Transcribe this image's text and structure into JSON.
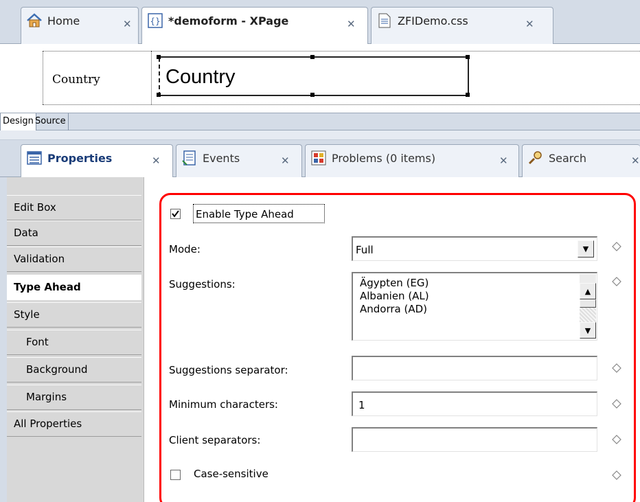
{
  "editor_tabs": [
    {
      "label": "Home",
      "icon": "home-icon"
    },
    {
      "label": "*demoform - XPage",
      "icon": "xpage-icon"
    },
    {
      "label": "ZFIDemo.css",
      "icon": "css-file-icon"
    }
  ],
  "canvas": {
    "label_text": "Country",
    "editbox_text": "Country"
  },
  "design_tabs": [
    "Design",
    "Source"
  ],
  "view_tabs": [
    {
      "label": "Properties",
      "icon": "properties-icon"
    },
    {
      "label": "Events",
      "icon": "events-icon"
    },
    {
      "label": "Problems (0 items)",
      "icon": "problems-icon"
    },
    {
      "label": "Search",
      "icon": "search-icon"
    }
  ],
  "nav": [
    {
      "label": "Edit Box"
    },
    {
      "label": "Data"
    },
    {
      "label": "Validation"
    },
    {
      "label": "Type Ahead"
    },
    {
      "label": "Style"
    },
    {
      "label": "Font"
    },
    {
      "label": "Background"
    },
    {
      "label": "Margins"
    },
    {
      "label": "All Properties"
    }
  ],
  "form": {
    "enable_label": "Enable Type Ahead",
    "enable_checked": true,
    "mode_label": "Mode:",
    "mode_value": "Full",
    "suggestions_label": "Suggestions:",
    "suggestions": [
      "Ägypten (EG)",
      "Albanien (AL)",
      "Andorra (AD)"
    ],
    "separator_label": "Suggestions separator:",
    "separator_value": "",
    "min_chars_label": "Minimum characters:",
    "min_chars_value": "1",
    "client_sep_label": "Client separators:",
    "client_sep_value": "",
    "case_label": "Case-sensitive",
    "case_checked": false
  },
  "colors": {
    "highlight_frame": "#ff0000",
    "tab_bar": "#d4dce7",
    "nav_bg": "#d8d8d8"
  }
}
